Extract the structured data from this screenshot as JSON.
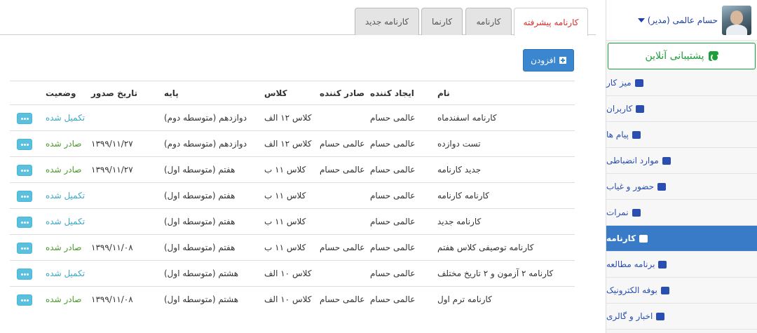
{
  "sidebar": {
    "user_name": "حسام عالمی (مدیر)",
    "support_label": "پشتیبانی آنلاین",
    "menu": [
      {
        "label": "میز کار",
        "icon": "home-icon"
      },
      {
        "label": "کاربران",
        "icon": "user-icon"
      },
      {
        "label": "پیام ها",
        "icon": "envelope-icon"
      },
      {
        "label": "موارد انضباطی",
        "icon": "users-icon"
      },
      {
        "label": "حضور و غیاب",
        "icon": "users-icon"
      },
      {
        "label": "نمرات",
        "icon": "bar-chart-icon"
      },
      {
        "label": "کارنامه",
        "icon": "list-icon"
      },
      {
        "label": "برنامه مطالعه",
        "icon": "clock-icon"
      },
      {
        "label": "بوفه الکترونیک",
        "icon": "cutlery-icon"
      },
      {
        "label": "اخبار و گالری",
        "icon": "film-icon"
      }
    ]
  },
  "tabs": [
    {
      "label": "کارنامه پیشرفته"
    },
    {
      "label": "کارنامه"
    },
    {
      "label": "کارنما"
    },
    {
      "label": "کارنامه جدید"
    }
  ],
  "toolbar": {
    "add_label": "افزودن"
  },
  "table": {
    "headers": {
      "name": "نام",
      "creator": "ایجاد کننده",
      "issuer": "صادر کننده",
      "class": "کلاس",
      "grade": "پایه",
      "date": "تاریخ صدور",
      "status": "وضعیت"
    },
    "rows": [
      {
        "name": "کارنامه اسفندماه",
        "creator": "عالمی حسام",
        "issuer": "",
        "class": "کلاس ۱۲ الف",
        "grade": "دوازدهم (متوسطه دوم)",
        "date": "",
        "status": "تکمیل شده"
      },
      {
        "name": "تست دوازده",
        "creator": "عالمی حسام",
        "issuer": "عالمی حسام",
        "class": "کلاس ۱۲ الف",
        "grade": "دوازدهم (متوسطه دوم)",
        "date": "۱۳۹۹/۱۱/۲۷",
        "status": "صادر شده"
      },
      {
        "name": "جدید کارنامه",
        "creator": "عالمی حسام",
        "issuer": "عالمی حسام",
        "class": "کلاس ۱۱ ب",
        "grade": "هفتم (متوسطه اول)",
        "date": "۱۳۹۹/۱۱/۲۷",
        "status": "صادر شده"
      },
      {
        "name": "کارنامه کارنامه",
        "creator": "عالمی حسام",
        "issuer": "",
        "class": "کلاس ۱۱ ب",
        "grade": "هفتم (متوسطه اول)",
        "date": "",
        "status": "تکمیل شده"
      },
      {
        "name": "کارنامه جدید",
        "creator": "عالمی حسام",
        "issuer": "",
        "class": "کلاس ۱۱ ب",
        "grade": "هفتم (متوسطه اول)",
        "date": "",
        "status": "تکمیل شده"
      },
      {
        "name": "کارنامه توصیفی کلاس هفتم",
        "creator": "عالمی حسام",
        "issuer": "عالمی حسام",
        "class": "کلاس ۱۱ ب",
        "grade": "هفتم (متوسطه اول)",
        "date": "۱۳۹۹/۱۱/۰۸",
        "status": "صادر شده"
      },
      {
        "name": "کارنامه ۲ آزمون و ۲ تاریخ مختلف",
        "creator": "عالمی حسام",
        "issuer": "",
        "class": "کلاس ۱۰ الف",
        "grade": "هشتم (متوسطه اول)",
        "date": "",
        "status": "تکمیل شده"
      },
      {
        "name": "کارنامه ترم اول",
        "creator": "عالمی حسام",
        "issuer": "عالمی حسام",
        "class": "کلاس ۱۰ الف",
        "grade": "هشتم (متوسطه اول)",
        "date": "۱۳۹۹/۱۱/۰۸",
        "status": "صادر شده"
      }
    ]
  },
  "colors": {
    "accent": "#3b87cf",
    "active_tab_text": "#d9302c",
    "status_done": "#3aa8c4",
    "status_issued": "#4a9a2a",
    "support_green": "#1e9e3a"
  }
}
